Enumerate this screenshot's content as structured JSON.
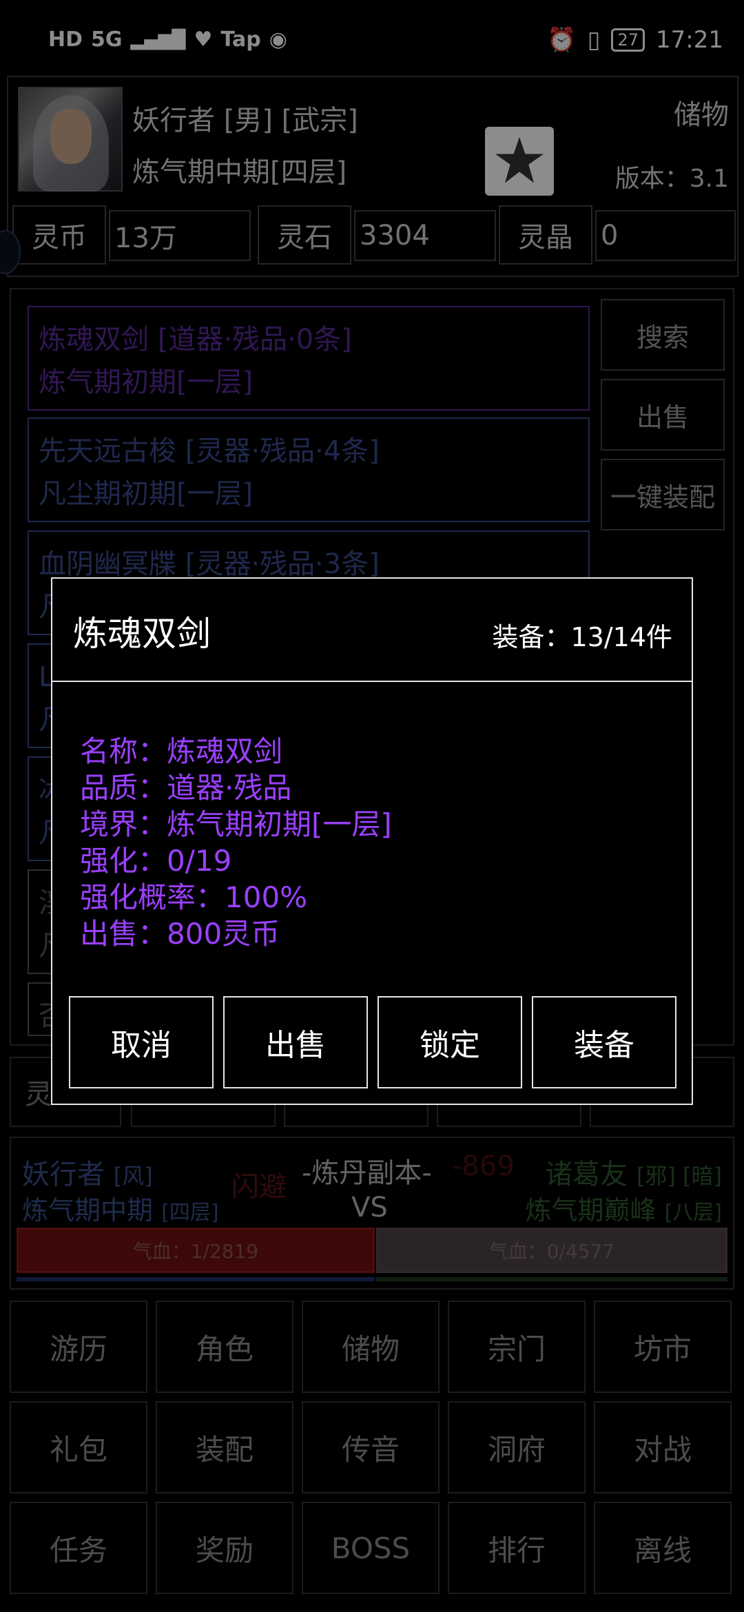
{
  "status_bar": {
    "left_items": [
      "HD",
      "5G",
      "Tap"
    ],
    "battery": "27",
    "time": "17:21"
  },
  "header": {
    "player_name": "妖行者 [男] [武宗]",
    "realm": "炼气期中期[四层]",
    "storage_link": "储物",
    "version": "版本：3.1",
    "currencies": [
      {
        "label": "灵币",
        "value": "13万"
      },
      {
        "label": "灵石",
        "value": "3304"
      },
      {
        "label": "灵晶",
        "value": "0"
      }
    ]
  },
  "inventory": {
    "items": [
      {
        "line1": "炼魂双剑 [道器·残品·0条]",
        "line2": "炼气期初期[一层]",
        "color": "#5a2a9a"
      },
      {
        "line1": "先天远古梭 [灵器·残品·4条]",
        "line2": "凡尘期初期[一层]",
        "color": "#3a4a8a"
      },
      {
        "line1": "血阴幽冥牒 [灵器·残品·3条]",
        "line2": "凡",
        "color": "#3a4a8a"
      },
      {
        "line1": "L",
        "line2": "凡",
        "color": "#3a4a8a"
      },
      {
        "line1": "冰",
        "line2": "凡",
        "color": "#3a4a8a"
      },
      {
        "line1": "淫",
        "line2": "凡",
        "color": "#555555"
      },
      {
        "line1": "否",
        "line2": "",
        "color": "#555555"
      }
    ],
    "side_buttons": [
      "搜索",
      "出售",
      "一键装配"
    ],
    "bottom_tab_partial": "灵"
  },
  "battle": {
    "player_name": "妖行者",
    "player_tag": "[风]",
    "player_realm": "炼气期中期",
    "player_layer": "[四层]",
    "dodge": "闪避",
    "dungeon": "-炼丹副本-",
    "damage": "-869",
    "vs": "VS",
    "enemy_name": "诸葛友",
    "enemy_tags": "[邪] [暗]",
    "enemy_realm": "炼气期巅峰",
    "enemy_layer": "[八层]",
    "player_hp": "气血：1/2819",
    "enemy_hp": "气血：0/4577",
    "player_hp_color": "#7a1010",
    "enemy_hp_color": "#5a4a4c"
  },
  "nav": [
    [
      "游历",
      "角色",
      "储物",
      "宗门",
      "坊市"
    ],
    [
      "礼包",
      "装配",
      "传音",
      "洞府",
      "对战"
    ],
    [
      "任务",
      "奖励",
      "BOSS",
      "排行",
      "离线"
    ]
  ],
  "modal": {
    "title": "炼魂双剑",
    "equip_count": "装备：13/14件",
    "details": [
      "名称：炼魂双剑",
      "品质：道器·残品",
      "境界：炼气期初期[一层]",
      "强化：0/19",
      "强化概率：100%",
      "出售：800灵币"
    ],
    "detail_color": "#9b40ff",
    "buttons": [
      "取消",
      "出售",
      "锁定",
      "装备"
    ]
  }
}
